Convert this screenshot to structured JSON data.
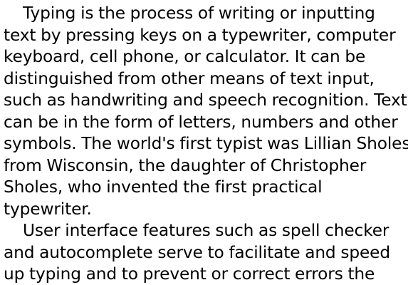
{
  "document": {
    "lines": [
      "    Typing is the process of writing or inputting",
      "text by pressing keys on a typewriter, computer",
      "keyboard, cell phone, or calculator. It can be",
      "distinguished from other means of text input,",
      "such as handwriting and speech recognition. Text",
      "can be in the form of letters, numbers and other",
      "symbols. The world's first typist was Lillian Sholes",
      "from Wisconsin, the daughter of Christopher",
      "Sholes, who invented the first practical",
      "typewriter.",
      "    User interface features such as spell checker",
      "and autocomplete serve to facilitate and speed",
      "up typing and to prevent or correct errors the"
    ]
  }
}
